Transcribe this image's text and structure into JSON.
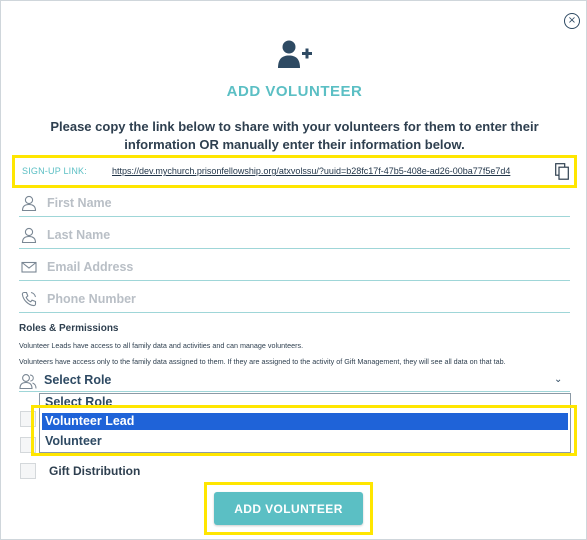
{
  "modal": {
    "close_glyph": "×",
    "header_icon": "add-user-icon",
    "title": "ADD VOLUNTEER",
    "instructions": "Please copy the link below to share with your volunteers for them to enter their information OR manually enter their information below."
  },
  "signup": {
    "label": "SIGN-UP LINK:",
    "url": "https://dev.mychurch.prisonfellowship.org/atxvolssu/?uuid=b28fc17f-47b5-408e-ad26-00ba77f5e7d4",
    "copy_icon": "copy-icon"
  },
  "fields": {
    "first_name": {
      "placeholder": "First Name",
      "value": ""
    },
    "last_name": {
      "placeholder": "Last Name",
      "value": ""
    },
    "email": {
      "placeholder": "Email Address",
      "value": ""
    },
    "phone": {
      "placeholder": "Phone Number",
      "value": ""
    }
  },
  "roles": {
    "title": "Roles & Permissions",
    "desc_lead": "Volunteer Leads have access to all family data and activities and can manage volunteers.",
    "desc_volunteer": "Volunteers have access only to the family data assigned to them. If they are assigned to the activity of Gift Management, they will see all data on that tab.",
    "select_value": "Select Role",
    "caret": "⌄",
    "options": [
      "Select Role",
      "Volunteer Lead",
      "Volunteer"
    ],
    "selected_option": "Volunteer Lead"
  },
  "activities": {
    "gift_distribution": "Gift Distribution"
  },
  "footer": {
    "add_button": "ADD VOLUNTEER"
  },
  "colors": {
    "accent": "#5bbfc4",
    "highlight": "#ffe600",
    "text_dark": "#2e3f4f",
    "option_selected": "#1f63d8"
  }
}
